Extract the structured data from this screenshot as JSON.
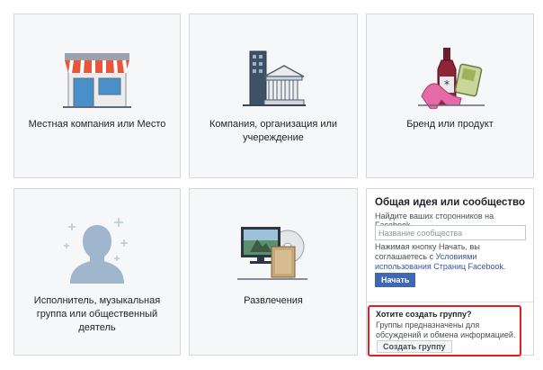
{
  "categories": [
    {
      "label": "Местная компания или Место",
      "icon": "storefront-icon"
    },
    {
      "label": "Компания, организация или учереждение",
      "icon": "buildings-icon"
    },
    {
      "label": "Бренд или продукт",
      "icon": "brand-products-icon"
    },
    {
      "label": "Исполнитель, музыкальная группа или общественный деятель",
      "icon": "person-stars-icon"
    },
    {
      "label": "Развлечения",
      "icon": "entertainment-icon"
    }
  ],
  "community": {
    "title": "Общая идея или сообщество",
    "subtitle": "Найдите ваших сторонников на Facebook.",
    "name_placeholder": "Название сообщества",
    "terms_prefix": "Нажимая кнопку Начать, вы соглашаетесь с ",
    "terms_link": "Условиями использования Страниц Facebook.",
    "start_button": "Начать"
  },
  "group": {
    "title": "Хотите создать группу?",
    "text": "Группы предназначены для обсуждений и обмена информацией.",
    "button": "Создать группу"
  },
  "colors": {
    "accent": "#4267b2",
    "link": "#365899",
    "highlight": "#e02020",
    "tile_bg": "#f6f7f9"
  }
}
